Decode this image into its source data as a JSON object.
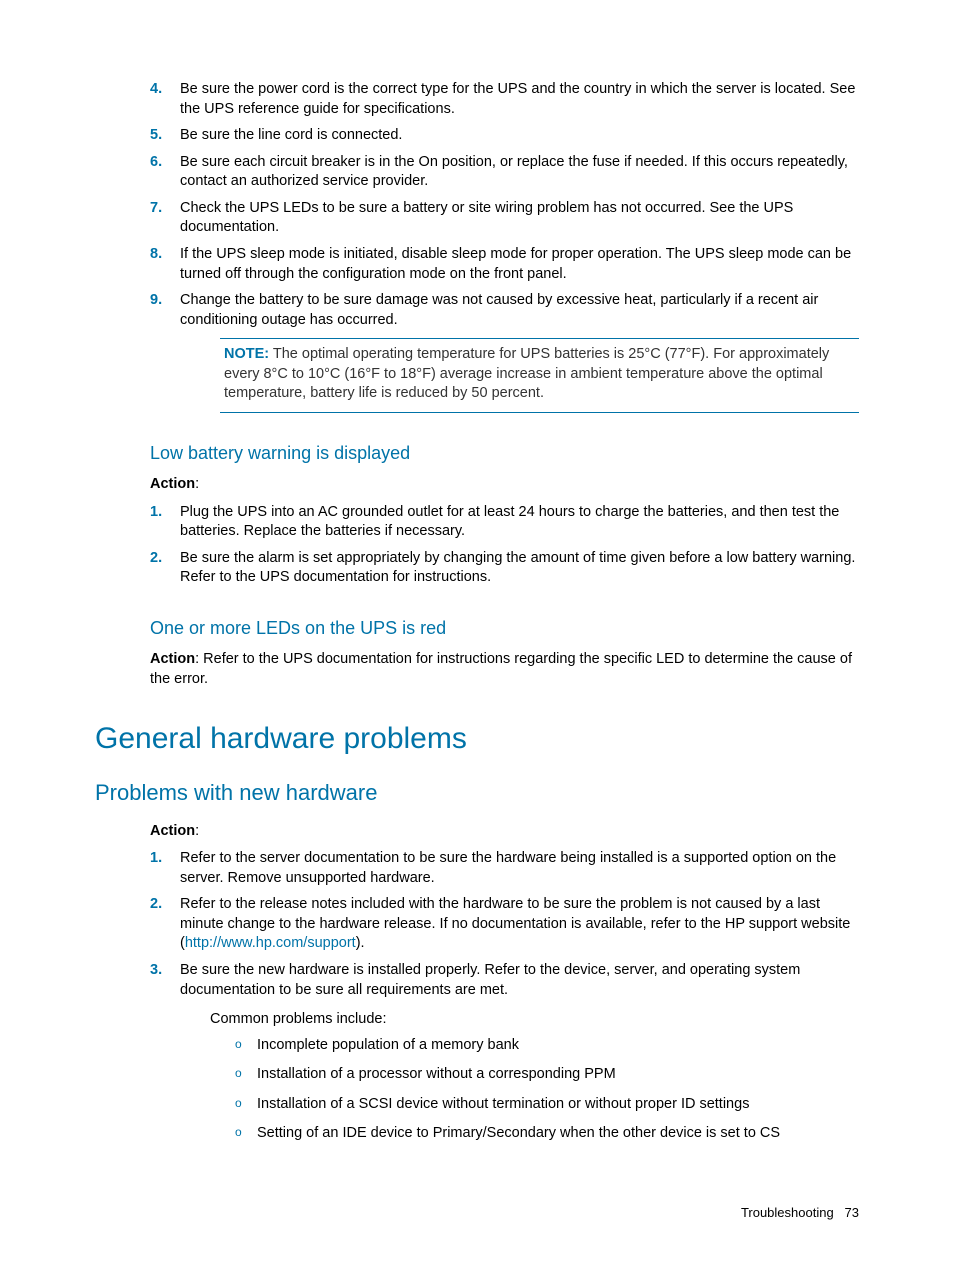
{
  "list1": {
    "items": [
      {
        "n": "4.",
        "t": "Be sure the power cord is the correct type for the UPS and the country in which the server is located. See the UPS reference guide for specifications."
      },
      {
        "n": "5.",
        "t": "Be sure the line cord is connected."
      },
      {
        "n": "6.",
        "t": "Be sure each circuit breaker is in the On position, or replace the fuse if needed. If this occurs repeatedly, contact an authorized service provider."
      },
      {
        "n": "7.",
        "t": "Check the UPS LEDs to be sure a battery or site wiring problem has not occurred. See the UPS documentation."
      },
      {
        "n": "8.",
        "t": "If the UPS sleep mode is initiated, disable sleep mode for proper operation. The UPS sleep mode can be turned off through the configuration mode on the front panel."
      },
      {
        "n": "9.",
        "t": "Change the battery to be sure damage was not caused by excessive heat, particularly if a recent air conditioning outage has occurred."
      }
    ]
  },
  "note": {
    "label": "NOTE:",
    "text": "  The optimal operating temperature for UPS batteries is 25°C (77°F). For approximately every 8°C to 10°C (16°F to 18°F) average increase in ambient temperature above the optimal temperature, battery life is reduced by 50 percent."
  },
  "section_low_battery": {
    "title": "Low battery warning is displayed",
    "action_label": "Action",
    "colon": ":",
    "items": [
      {
        "n": "1.",
        "t": "Plug the UPS into an AC grounded outlet for at least 24 hours to charge the batteries, and then test the batteries. Replace the batteries if necessary."
      },
      {
        "n": "2.",
        "t": "Be sure the alarm is set appropriately by changing the amount of time given before a low battery warning. Refer to the UPS documentation for instructions."
      }
    ]
  },
  "section_leds": {
    "title": "One or more LEDs on the UPS is red",
    "action_label": "Action",
    "text": ": Refer to the UPS documentation for instructions regarding the specific LED to determine the cause of the error."
  },
  "heading_main": "General hardware problems",
  "heading_sub": "Problems with new hardware",
  "section_new_hw": {
    "action_label": "Action",
    "colon": ":",
    "items": [
      {
        "n": "1.",
        "t": "Refer to the server documentation to be sure the hardware being installed is a supported option on the server. Remove unsupported hardware."
      },
      {
        "n": "2.",
        "pre": "Refer to the release notes included with the hardware to be sure the problem is not caused by a last minute change to the hardware release. If no documentation is available, refer to the HP support website (",
        "link": "http://www.hp.com/support",
        "post": ")."
      },
      {
        "n": "3.",
        "t": "Be sure the new hardware is installed properly. Refer to the device, server, and operating system documentation to be sure all requirements are met."
      }
    ],
    "common_label": "Common problems include:",
    "bullets": [
      "Incomplete population of a memory bank",
      "Installation of a processor without a corresponding PPM",
      "Installation of a SCSI device without termination or without proper ID settings",
      "Setting of an IDE device to Primary/Secondary when the other device is set to CS"
    ]
  },
  "footer": {
    "section": "Troubleshooting",
    "page": "73"
  }
}
